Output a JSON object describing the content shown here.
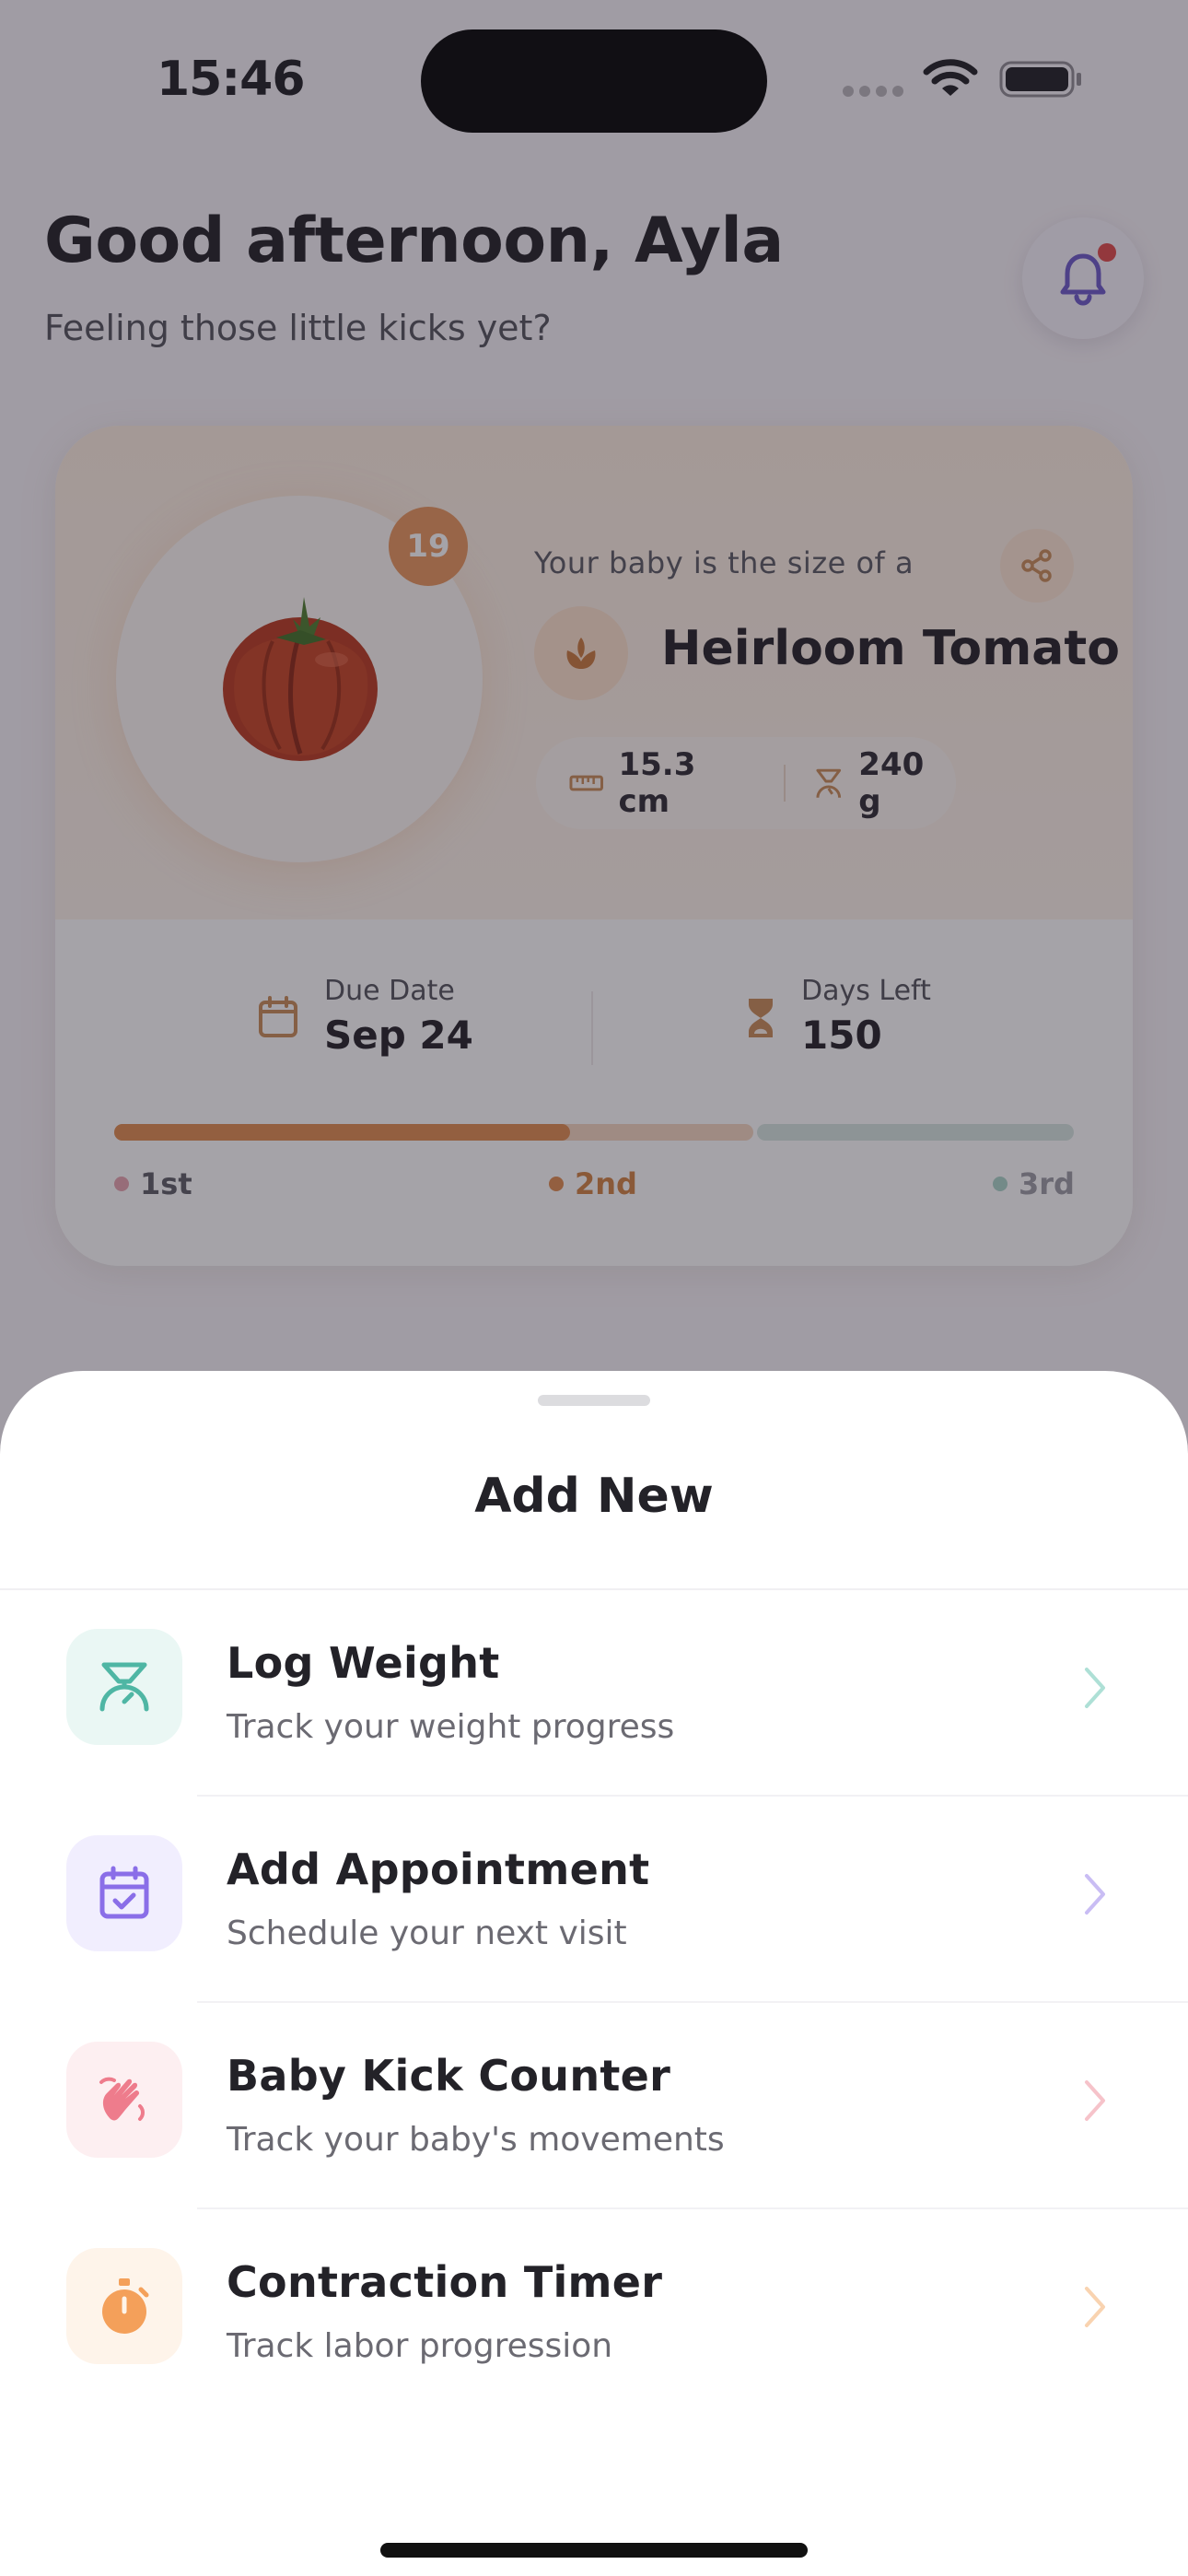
{
  "status_bar": {
    "time": "15:46"
  },
  "header": {
    "greeting": "Good afternoon, Ayla",
    "subtitle": "Feeling those little kicks yet?"
  },
  "baby_card": {
    "week": "19",
    "size_caption": "Your baby is the size of a",
    "fruit_name": "Heirloom Tomato",
    "length": "15.3 cm",
    "weight": "240 g",
    "due_date_label": "Due Date",
    "due_date_value": "Sep 24",
    "days_left_label": "Days Left",
    "days_left_value": "150",
    "progress_fraction": 0.475,
    "trimesters": [
      {
        "label": "1st",
        "color": "#c9a3a8"
      },
      {
        "label": "2nd",
        "color": "#c98a55"
      },
      {
        "label": "3rd",
        "color": "#a9c4bd"
      }
    ]
  },
  "sheet": {
    "title": "Add New",
    "items": [
      {
        "title": "Log Weight",
        "subtitle": "Track your weight progress",
        "icon": "scale-icon",
        "accent": "#4fb6a4",
        "bg": "#eaf7f4"
      },
      {
        "title": "Add Appointment",
        "subtitle": "Schedule your next visit",
        "icon": "calendar-check-icon",
        "accent": "#8a6ee8",
        "bg": "#f1eefe"
      },
      {
        "title": "Baby Kick Counter",
        "subtitle": "Track your baby's movements",
        "icon": "hand-wave-icon",
        "accent": "#ee7c8c",
        "bg": "#fdeff1"
      },
      {
        "title": "Contraction Timer",
        "subtitle": "Track labor progression",
        "icon": "stopwatch-icon",
        "accent": "#f4a05a",
        "bg": "#fef4ea"
      }
    ]
  },
  "colors": {
    "accent_orange": "#e8955a",
    "bell_purple": "#6a57c8",
    "notification_dot": "#e04848"
  }
}
